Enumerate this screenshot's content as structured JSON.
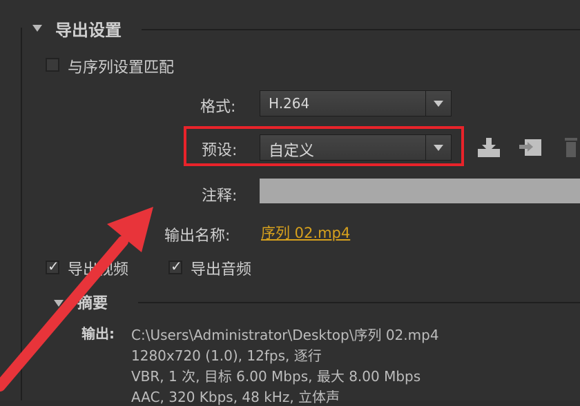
{
  "export_settings": {
    "title": "导出设置",
    "match_sequence_label": "与序列设置匹配",
    "format_label": "格式:",
    "format_value": "H.264",
    "preset_label": "预设:",
    "preset_value": "自定义",
    "comment_label": "注释:",
    "comment_value": "",
    "output_name_label": "输出名称:",
    "output_name_value": "序列 02.mp4",
    "export_video_label": "导出视频",
    "export_audio_label": "导出音频"
  },
  "summary": {
    "title": "摘要",
    "output_label": "输出:",
    "output_lines": [
      "C:\\Users\\Administrator\\Desktop\\序列 02.mp4",
      "1280x720 (1.0), 12fps, 逐行",
      "VBR, 1 次, 目标 6.00 Mbps, 最大 8.00 Mbps",
      "AAC, 320 Kbps, 48 kHz, 立体声"
    ]
  },
  "icons": [
    "save-preset-icon",
    "import-preset-icon",
    "delete-preset-icon"
  ],
  "colors": {
    "highlight": "#e8232a",
    "link": "#d7a11d",
    "arrow": "#e8343a"
  }
}
